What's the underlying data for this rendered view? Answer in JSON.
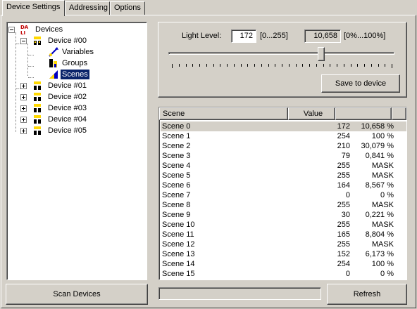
{
  "tabs": [
    {
      "label": "Device Settings"
    },
    {
      "label": "Addressing"
    },
    {
      "label": "Options"
    }
  ],
  "tree": {
    "root": "Devices",
    "device0": "Device #00",
    "children": [
      "Variables",
      "Groups",
      "Scenes"
    ],
    "devices": [
      "Device #01",
      "Device #02",
      "Device #03",
      "Device #04",
      "Device #05"
    ]
  },
  "light": {
    "label": "Light Level:",
    "value": "172",
    "range": "[0...255]",
    "percent": "10,658",
    "percent_range": "[0%...100%]",
    "slider_fraction": 0.675
  },
  "save_label": "Save to device",
  "scan_label": "Scan Devices",
  "refresh_label": "Refresh",
  "list": {
    "headers": [
      "Scene",
      "Value",
      ""
    ],
    "rows": [
      {
        "scene": "Scene 0",
        "value": "172",
        "pct": "10,658 %"
      },
      {
        "scene": "Scene 1",
        "value": "254",
        "pct": "100 %"
      },
      {
        "scene": "Scene 2",
        "value": "210",
        "pct": "30,079 %"
      },
      {
        "scene": "Scene 3",
        "value": "79",
        "pct": "0,841 %"
      },
      {
        "scene": "Scene 4",
        "value": "255",
        "pct": "MASK"
      },
      {
        "scene": "Scene 5",
        "value": "255",
        "pct": "MASK"
      },
      {
        "scene": "Scene 6",
        "value": "164",
        "pct": "8,567 %"
      },
      {
        "scene": "Scene 7",
        "value": "0",
        "pct": "0 %"
      },
      {
        "scene": "Scene 8",
        "value": "255",
        "pct": "MASK"
      },
      {
        "scene": "Scene 9",
        "value": "30",
        "pct": "0,221 %"
      },
      {
        "scene": "Scene 10",
        "value": "255",
        "pct": "MASK"
      },
      {
        "scene": "Scene 11",
        "value": "165",
        "pct": "8,804 %"
      },
      {
        "scene": "Scene 12",
        "value": "255",
        "pct": "MASK"
      },
      {
        "scene": "Scene 13",
        "value": "152",
        "pct": "6,173 %"
      },
      {
        "scene": "Scene 14",
        "value": "254",
        "pct": "100 %"
      },
      {
        "scene": "Scene 15",
        "value": "0",
        "pct": "0 %"
      }
    ]
  }
}
